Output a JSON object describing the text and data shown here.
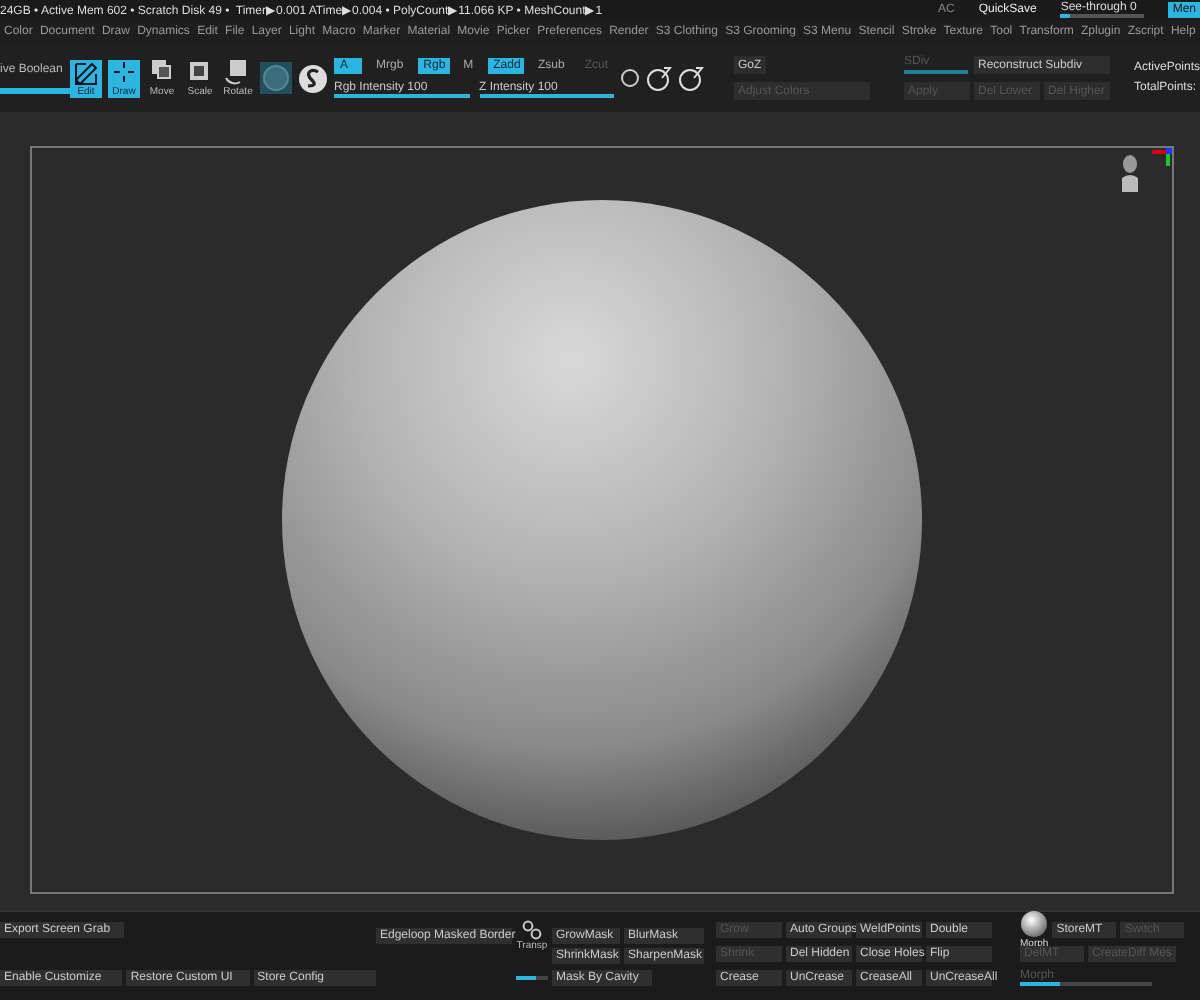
{
  "status_bar": {
    "text": "24GB • Active Mem 602 • Scratch Disk 49 •  Timer▶0.001 ATime▶0.004 • PolyCount▶11.066 KP • MeshCount▶1",
    "ac": "AC",
    "quicksave": "QuickSave",
    "see_through": {
      "label": "See-through  0",
      "level": 0.1
    },
    "menus": {
      "label": "Men",
      "selected": true
    }
  },
  "menus": [
    "Color",
    "Document",
    "Draw",
    "Dynamics",
    "Edit",
    "File",
    "Layer",
    "Light",
    "Macro",
    "Marker",
    "Material",
    "Movie",
    "Picker",
    "Preferences",
    "Render",
    "S3 Clothing",
    "S3 Grooming",
    "S3 Menu",
    "Stencil",
    "Stroke",
    "Texture",
    "Tool",
    "Transform",
    "Zplugin",
    "Zscript",
    "Help"
  ],
  "toolbar": {
    "label": "ive Boolean",
    "tools": [
      {
        "label": "Edit",
        "kind": "edit",
        "selected": true
      },
      {
        "label": "Draw",
        "kind": "draw",
        "selected": true
      },
      {
        "label": "Move",
        "kind": "move",
        "selected": false
      },
      {
        "label": "Scale",
        "kind": "scale",
        "selected": false
      },
      {
        "label": "Rotate",
        "kind": "rotate",
        "selected": false
      }
    ],
    "modes": [
      {
        "label": "A",
        "selected": true,
        "disabled": false
      },
      {
        "label": "Mrgb",
        "selected": false,
        "disabled": false
      },
      {
        "label": "Rgb",
        "selected": true,
        "disabled": false
      },
      {
        "label": "M",
        "selected": false,
        "disabled": false
      },
      {
        "label": "Zadd",
        "selected": true,
        "disabled": false
      },
      {
        "label": "Zsub",
        "selected": false,
        "disabled": false
      },
      {
        "label": "Zcut",
        "selected": false,
        "disabled": true
      }
    ],
    "sliders": [
      {
        "label": "Rgb Intensity 100",
        "level": 1
      },
      {
        "label": "Z Intensity 100",
        "level": 1
      }
    ],
    "goz": {
      "label": "GoZ",
      "disabled": false
    },
    "adjust_colors": {
      "label": "Adjust Colors",
      "disabled": true
    },
    "sdiv": {
      "label": "SDiv",
      "disabled": true,
      "level": 1
    },
    "apply": {
      "label": "Apply",
      "disabled": true
    },
    "reconstruct": {
      "label": "Reconstruct Subdiv",
      "disabled": false
    },
    "del_buttons": [
      {
        "label": "Del Lower",
        "disabled": true
      },
      {
        "label": "Del Higher",
        "disabled": true
      }
    ],
    "stats": [
      "ActivePoints",
      "TotalPoints:"
    ]
  },
  "shelf": [
    {
      "rows": [
        [
          {
            "kind": "button",
            "label": "Export Screen Grab",
            "disabled": false
          }
        ],
        [],
        [
          {
            "kind": "button",
            "label": "Enable Customize",
            "disabled": false
          },
          {
            "kind": "button",
            "label": "Restore Custom UI",
            "disabled": false
          },
          {
            "kind": "button",
            "label": "Store Config",
            "disabled": false
          }
        ]
      ]
    },
    {
      "rows": [
        [
          {
            "kind": "button",
            "label": "Edgeloop Masked Border",
            "disabled": false
          },
          {
            "kind": "transp",
            "label": "Transp"
          },
          {
            "kind": "button",
            "label": "GrowMask",
            "disabled": false
          },
          {
            "kind": "button",
            "label": "BlurMask",
            "disabled": false
          }
        ],
        [
          "",
          "",
          {
            "kind": "button",
            "label": "ShrinkMask",
            "disabled": false
          },
          {
            "kind": "button",
            "label": "SharpenMask",
            "disabled": false
          }
        ],
        [
          "",
          {
            "kind": "slider",
            "level": 0.6
          },
          {
            "kind": "button",
            "label": "Mask By Cavity",
            "disabled": false
          }
        ]
      ]
    },
    {
      "rows": [
        [
          {
            "kind": "button",
            "label": "Grow",
            "disabled": true
          },
          {
            "kind": "button",
            "label": "Auto Groups",
            "disabled": false
          },
          {
            "kind": "button",
            "label": "WeldPoints",
            "disabled": false
          },
          {
            "kind": "button",
            "label": "Double",
            "disabled": false
          }
        ],
        [
          {
            "kind": "button",
            "label": "Shrink",
            "disabled": true
          },
          {
            "kind": "button",
            "label": "Del Hidden",
            "disabled": false
          },
          {
            "kind": "button",
            "label": "Close Holes",
            "disabled": false
          },
          {
            "kind": "button",
            "label": "Flip",
            "disabled": false
          }
        ],
        [
          {
            "kind": "button",
            "label": "Crease",
            "disabled": false
          },
          {
            "kind": "button",
            "label": "UnCrease",
            "disabled": false
          },
          {
            "kind": "button",
            "label": "CreaseAll",
            "disabled": false
          },
          {
            "kind": "button",
            "label": "UnCreaseAll",
            "disabled": false
          }
        ]
      ]
    },
    {
      "rows": [
        [
          {
            "kind": "morph",
            "label": "Morph"
          },
          {
            "kind": "button",
            "label": "StoreMT",
            "disabled": false
          },
          {
            "kind": "button",
            "label": "Switch",
            "disabled": true
          }
        ],
        [
          {
            "kind": "button",
            "label": "DelMT",
            "disabled": true
          },
          {
            "kind": "button",
            "label": "CreateDiff Mes",
            "disabled": true
          }
        ],
        [
          {
            "kind": "slider",
            "label": "Morph",
            "disabled": true,
            "level": 0.3
          }
        ]
      ]
    }
  ]
}
